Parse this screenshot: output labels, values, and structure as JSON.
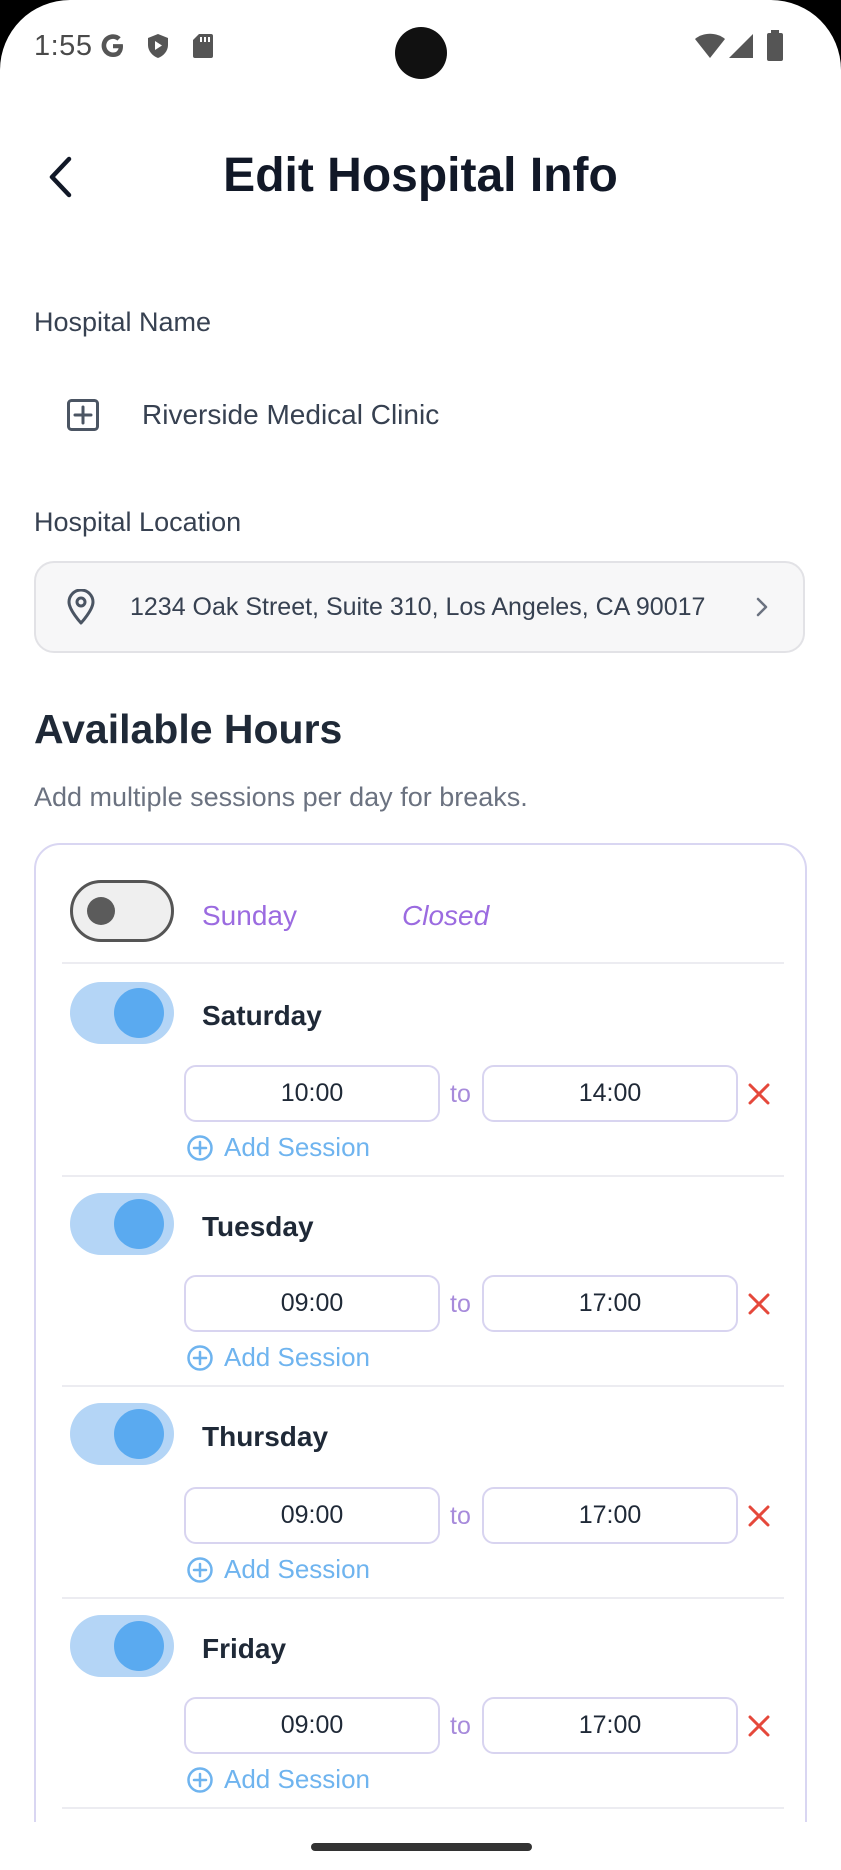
{
  "status_bar": {
    "time": "1:55",
    "icons": [
      "google-icon",
      "shield-icon",
      "sd-card-icon",
      "wifi-icon",
      "signal-icon",
      "battery-icon"
    ]
  },
  "header": {
    "back_icon": "chevron-left-icon",
    "title": "Edit Hospital Info"
  },
  "hospital_name": {
    "label": "Hospital Name",
    "icon": "plus-square-icon",
    "value": "Riverside Medical Clinic"
  },
  "hospital_location": {
    "label": "Hospital Location",
    "icon": "map-pin-icon",
    "value": "1234 Oak Street, Suite 310, Los Angeles, CA 90017",
    "chevron": "chevron-right-icon"
  },
  "available_hours": {
    "title": "Available Hours",
    "subtitle": "Add multiple sessions per day for breaks.",
    "closed_label": "Closed",
    "to_label": "to",
    "add_session_label": "Add Session",
    "days": [
      {
        "name": "Sunday",
        "enabled": false
      },
      {
        "name": "Saturday",
        "enabled": true,
        "start": "10:00",
        "end": "14:00"
      },
      {
        "name": "Tuesday",
        "enabled": true,
        "start": "09:00",
        "end": "17:00"
      },
      {
        "name": "Thursday",
        "enabled": true,
        "start": "09:00",
        "end": "17:00"
      },
      {
        "name": "Friday",
        "enabled": true,
        "start": "09:00",
        "end": "17:00"
      }
    ]
  },
  "colors": {
    "accent_purple": "#9b6be0",
    "toggle_on": "#5aaaf0",
    "toggle_track_on": "#b4d5f6",
    "remove_red": "#e5483b",
    "add_session_blue": "#6fb4ef"
  }
}
